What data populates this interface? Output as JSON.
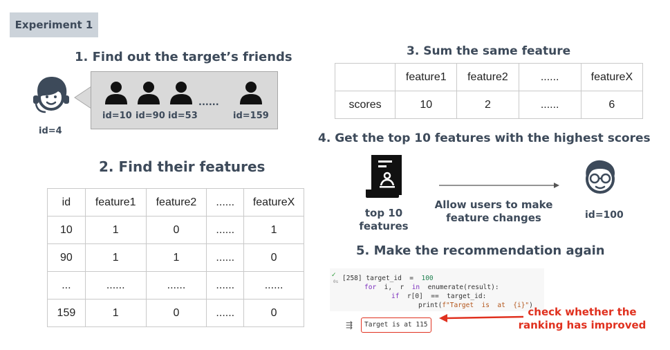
{
  "tag": "Experiment 1",
  "step1": {
    "title": "1. Find out the target’s friends",
    "target_id": "id=4",
    "friend_ids": [
      "id=10",
      "id=90",
      "id=53",
      "id=159"
    ],
    "ellipsis": "......"
  },
  "step2": {
    "title": "2. Find their features",
    "table": {
      "headers": [
        "id",
        "feature1",
        "feature2",
        "......",
        "featureX"
      ],
      "rows": [
        [
          "10",
          "1",
          "0",
          "......",
          "1"
        ],
        [
          "90",
          "1",
          "1",
          "......",
          "0"
        ],
        [
          "...",
          "......",
          "......",
          "......",
          "......"
        ],
        [
          "159",
          "1",
          "0",
          "......",
          "0"
        ]
      ]
    }
  },
  "step3": {
    "title": "3. Sum the same feature",
    "table": {
      "headers": [
        "",
        "feature1",
        "feature2",
        "......",
        "featureX"
      ],
      "row": [
        "scores",
        "10",
        "2",
        "......",
        "6"
      ]
    }
  },
  "step4": {
    "title": "4. Get the top 10 features with the highest scores",
    "doc_label": "top 10\nfeatures",
    "arrow_label": "Allow users to make\nfeature changes",
    "user_id": "id=100"
  },
  "step5": {
    "title": "5. Make the recommendation again",
    "cell_number": "[258]",
    "code": {
      "l1_a": "target_id",
      "l1_b": "=",
      "l1_c": "100",
      "l2_a": "for",
      "l2_b": "i,  r",
      "l2_c": "in",
      "l2_d": "enumerate(result):",
      "l3_a": "if",
      "l3_b": "r[0]  ==  target_id:",
      "l4_a": "print(",
      "l4_b": "f\"Target  is  at  {i}\"",
      "l4_c": ")"
    },
    "output": "Target is at 115",
    "note": "check whether the\nranking has improved"
  },
  "colors": {
    "heading": "#3d4a5a",
    "accent_red": "#e0311f",
    "tag_bg": "#ccd3da",
    "bubble_bg": "#d9d9d9"
  }
}
